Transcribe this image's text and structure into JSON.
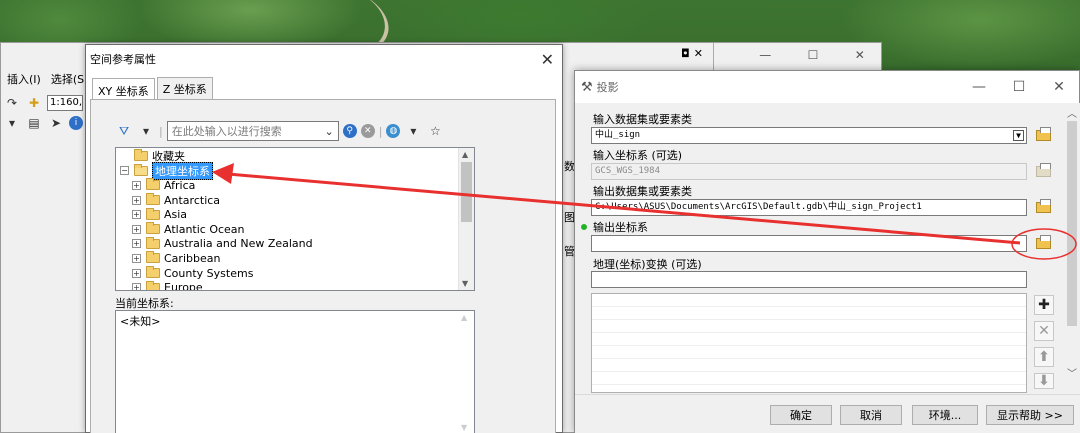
{
  "background": {
    "accent": "#2f5f27"
  },
  "arcmap": {
    "menu": [
      "插入(I)",
      "选择(S"
    ],
    "scale_value": "1:160,",
    "side_chars": [
      "数",
      "图",
      "管"
    ],
    "close_glyph": "✕",
    "window_controls": [
      "—",
      "☐",
      "✕"
    ]
  },
  "sr_dialog": {
    "title": "空间参考属性",
    "tabs": [
      "XY 坐标系",
      "Z 坐标系"
    ],
    "search_placeholder": "在此处输入以进行搜索",
    "tree": [
      {
        "label": "收藏夹",
        "expander": "",
        "open": false,
        "selected": false
      },
      {
        "label": "地理坐标系",
        "expander": "⊟",
        "open": true,
        "selected": true
      },
      {
        "label": "Africa",
        "expander": "⊞",
        "open": false,
        "selected": false
      },
      {
        "label": "Antarctica",
        "expander": "⊞",
        "open": false,
        "selected": false
      },
      {
        "label": "Asia",
        "expander": "⊞",
        "open": false,
        "selected": false
      },
      {
        "label": "Atlantic Ocean",
        "expander": "⊞",
        "open": false,
        "selected": false
      },
      {
        "label": "Australia and New Zealand",
        "expander": "⊞",
        "open": false,
        "selected": false
      },
      {
        "label": "Caribbean",
        "expander": "⊞",
        "open": false,
        "selected": false
      },
      {
        "label": "County Systems",
        "expander": "⊞",
        "open": false,
        "selected": false
      },
      {
        "label": "Europe",
        "expander": "⊞",
        "open": false,
        "selected": false
      }
    ],
    "current_label": "当前坐标系:",
    "current_value": "<未知>"
  },
  "proj_dialog": {
    "title": "投影",
    "window_controls": [
      "—",
      "☐",
      "✕"
    ],
    "fields": {
      "input_dataset_label": "输入数据集或要素类",
      "input_dataset_value": "中山_sign",
      "input_cs_label": "输入坐标系 (可选)",
      "input_cs_value": "GCS_WGS_1984",
      "output_dataset_label": "输出数据集或要素类",
      "output_dataset_value": "C:\\Users\\ASUS\\Documents\\ArcGIS\\Default.gdb\\中山_sign_Project1",
      "output_cs_label": "输出坐标系",
      "output_cs_value": "",
      "geo_transform_label": "地理(坐标)变换 (可选)",
      "geo_transform_value": ""
    },
    "side_buttons": [
      "✚",
      "✕",
      "⬆",
      "⬇"
    ],
    "buttons": {
      "ok": "确定",
      "cancel": "取消",
      "env": "环境...",
      "help": "显示帮助 >>"
    }
  },
  "annotation": {
    "color": "#e8312f"
  }
}
